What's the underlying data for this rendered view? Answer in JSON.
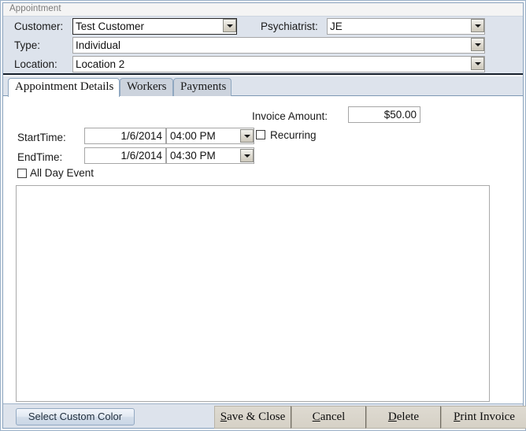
{
  "window": {
    "title": "Appointment"
  },
  "header": {
    "customer": {
      "label": "Customer:",
      "value": "Test Customer",
      "arrow": "chevron-down-icon"
    },
    "psychiatrist": {
      "label": "Psychiatrist:",
      "value": "JE"
    },
    "type": {
      "label": "Type:",
      "value": "Individual"
    },
    "location": {
      "label": "Location:",
      "value": "Location 2"
    }
  },
  "tabs": [
    {
      "label": "Appointment Details",
      "active": true
    },
    {
      "label": "Workers",
      "active": false
    },
    {
      "label": "Payments",
      "active": false
    }
  ],
  "details": {
    "invoice_amount_label": "Invoice Amount:",
    "invoice_amount_value": "$50.00",
    "start_time_label": "StartTime:",
    "start_date_value": "1/6/2014",
    "start_time_value": "04:00 PM",
    "end_time_label": "EndTime:",
    "end_date_value": "1/6/2014",
    "end_time_value": "04:30 PM",
    "recurring_label": "Recurring",
    "recurring_checked": false,
    "all_day_label": "All Day Event",
    "all_day_checked": false,
    "notes_value": ""
  },
  "footer": {
    "select_custom_color": "Select Custom Color",
    "save_close": {
      "pre": "",
      "key": "S",
      "post": "ave & Close"
    },
    "cancel": {
      "pre": "",
      "key": "C",
      "post": "ancel"
    },
    "delete": {
      "pre": "",
      "key": "D",
      "post": "elete"
    },
    "print_invoice": {
      "pre": "",
      "key": "P",
      "post": "rint Invoice"
    }
  },
  "colors": {
    "header_bg": "#dde3ec",
    "tab_active_bg": "#ffffff",
    "tab_inactive_bg": "#ccd3dd",
    "button_bg": "#d6d1c6",
    "frame_border": "#8ba4be"
  }
}
